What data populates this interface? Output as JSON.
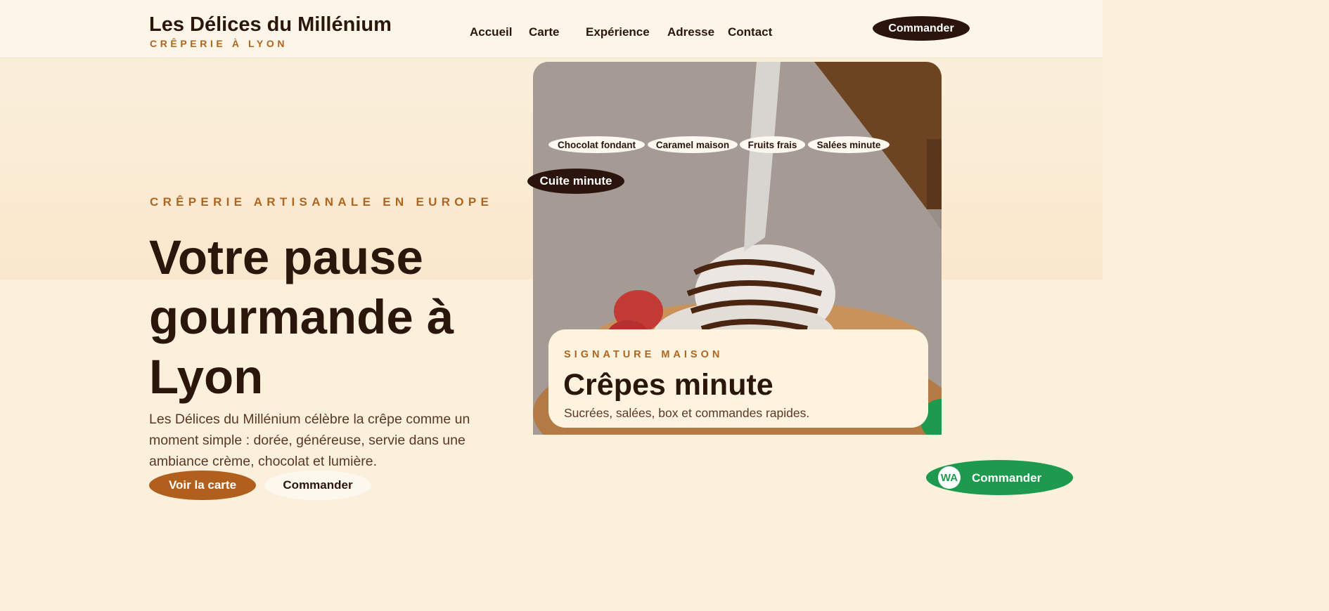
{
  "header": {
    "brand_title": "Les Délices du Millénium",
    "brand_subtitle": "CRÊPERIE À LYON",
    "nav": [
      "Accueil",
      "Carte",
      "Expérience",
      "Adresse",
      "Contact"
    ],
    "cta": "Commander"
  },
  "hero": {
    "eyebrow": "CRÊPERIE ARTISANALE EN EUROPE",
    "title": "Votre pause gourmande à Lyon",
    "description": "Les Délices du Millénium célèbre la crêpe comme un moment simple : dorée, généreuse, servie dans une ambiance crème, chocolat et lumière.",
    "primary_button": "Voir la carte",
    "secondary_button": "Commander"
  },
  "photo": {
    "tags": [
      "Chocolat fondant",
      "Caramel maison",
      "Fruits frais",
      "Salées minute"
    ],
    "badge": "Cuite minute",
    "card": {
      "eyebrow": "SIGNATURE MAISON",
      "title": "Crêpes minute",
      "description": "Sucrées, salées, box et commandes rapides."
    }
  },
  "whatsapp": {
    "icon_text": "WA",
    "label": "Commander"
  },
  "colors": {
    "accent": "#b0601c",
    "dark": "#2b140b",
    "cream": "#faf0dc",
    "whatsapp": "#1e9a4f"
  }
}
